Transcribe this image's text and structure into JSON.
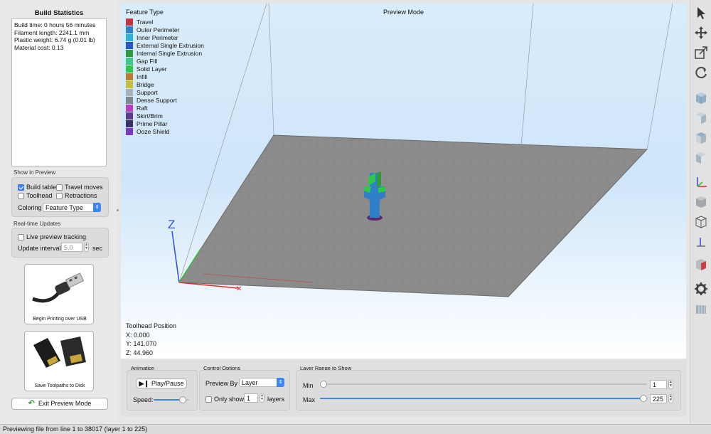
{
  "build_statistics": {
    "title": "Build Statistics",
    "lines": [
      "Build time: 0 hours 56 minutes",
      "Filament length: 2241.1 mm",
      "Plastic weight: 6.74 g (0.01 lb)",
      "Material cost: 0.13"
    ]
  },
  "show_in_preview": {
    "title": "Show in Preview",
    "build_table": {
      "label": "Build table",
      "checked": true
    },
    "travel_moves": {
      "label": "Travel moves",
      "checked": false
    },
    "toolhead": {
      "label": "Toolhead",
      "checked": false
    },
    "retractions": {
      "label": "Retractions",
      "checked": false
    },
    "coloring_label": "Coloring",
    "coloring_value": "Feature Type"
  },
  "realtime": {
    "title": "Real-time Updates",
    "live_preview": {
      "label": "Live preview tracking",
      "checked": false
    },
    "interval_label": "Update interval",
    "interval_value": "5,0",
    "interval_unit": "sec"
  },
  "usb_button": {
    "label": "Begin Printing over USB"
  },
  "sd_button": {
    "label": "Save Toolpaths to Disk"
  },
  "exit_button": {
    "label": "Exit Preview Mode"
  },
  "viewport": {
    "mode_title": "Preview Mode",
    "legend_title": "Feature Type",
    "legend": [
      {
        "label": "Travel",
        "color": "#c8313a"
      },
      {
        "label": "Outer Perimeter",
        "color": "#2f7fc9"
      },
      {
        "label": "Inner Perimeter",
        "color": "#2bb4d6"
      },
      {
        "label": "External Single Extrusion",
        "color": "#2a55c4"
      },
      {
        "label": "Internal Single Extrusion",
        "color": "#2f9a3c"
      },
      {
        "label": "Gap Fill",
        "color": "#3dc98a"
      },
      {
        "label": "Solid Layer",
        "color": "#2ec94a"
      },
      {
        "label": "Infill",
        "color": "#c07a2f"
      },
      {
        "label": "Bridge",
        "color": "#c6c037"
      },
      {
        "label": "Support",
        "color": "#a8b0b8"
      },
      {
        "label": "Dense Support",
        "color": "#7d8890"
      },
      {
        "label": "Raft",
        "color": "#b63cc0"
      },
      {
        "label": "Skirt/Brim",
        "color": "#5a3a8a"
      },
      {
        "label": "Prime Pillar",
        "color": "#3a2f6a"
      },
      {
        "label": "Ooze Shield",
        "color": "#7a3ac0"
      }
    ],
    "axis_z_label": "Z",
    "toolhead_title": "Toolhead Position",
    "toolhead_x": "X: 0.000",
    "toolhead_y": "Y: 141.070",
    "toolhead_z": "Z: 44.960"
  },
  "animation": {
    "title": "Animation",
    "play_label": "Play/Pause",
    "speed_label": "Speed:",
    "speed_fraction": 0.9
  },
  "control_options": {
    "title": "Control Options",
    "preview_by_label": "Preview By",
    "preview_by_value": "Layer",
    "only_show_label": "Only show",
    "only_show_checked": false,
    "only_show_value": "1",
    "layers_label": "layers"
  },
  "layer_range": {
    "title": "Layer Range to Show",
    "min_label": "Min",
    "min_value": "1",
    "max_label": "Max",
    "max_value": "225",
    "min_fraction": 0.0,
    "max_fraction": 1.0
  },
  "status_bar": {
    "text": "Previewing file from line 1 to 38017 (layer 1 to 225)"
  },
  "toolbar": {
    "icons": [
      "pointer-icon",
      "move-icon",
      "scale-icon",
      "rotate-icon",
      "view-iso-cube-icon",
      "view-front-cube-icon",
      "view-top-cube-icon",
      "view-side-cube-icon",
      "axes-icon",
      "solid-cube-icon",
      "wireframe-cube-icon",
      "axis-arrow-icon",
      "section-cube-icon",
      "settings-gear-icon",
      "column-icon"
    ]
  }
}
